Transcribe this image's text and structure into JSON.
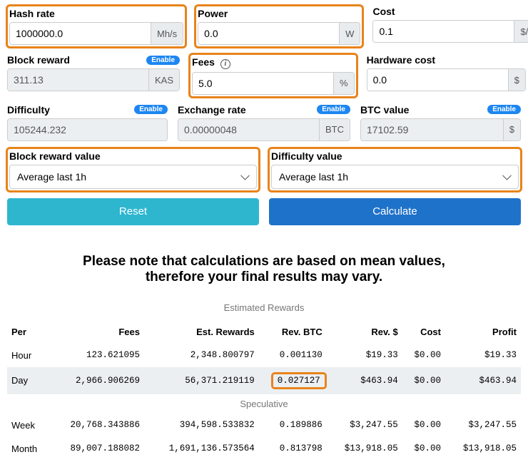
{
  "labels": {
    "hash_rate": "Hash rate",
    "power": "Power",
    "cost": "Cost",
    "block_reward": "Block reward",
    "fees": "Fees",
    "hardware_cost": "Hardware cost",
    "difficulty": "Difficulty",
    "exchange_rate": "Exchange rate",
    "btc_value": "BTC value",
    "block_reward_value": "Block reward value",
    "difficulty_value": "Difficulty value",
    "enable": "Enable",
    "reset": "Reset",
    "calculate": "Calculate"
  },
  "units": {
    "hash_rate": "Mh/s",
    "power": "W",
    "cost": "$/kWh",
    "block_reward": "KAS",
    "fees": "%",
    "hardware_cost": "$",
    "exchange_rate": "BTC",
    "btc_value": "$"
  },
  "values": {
    "hash_rate": "1000000.0",
    "power": "0.0",
    "cost": "0.1",
    "block_reward": "311.13",
    "fees": "5.0",
    "hardware_cost": "0.0",
    "difficulty": "105244.232",
    "exchange_rate": "0.00000048",
    "btc_value": "17102.59"
  },
  "selects": {
    "block_reward_value": "Average last 1h",
    "difficulty_value": "Average last 1h"
  },
  "note": {
    "l1": "Please note that calculations are based on mean values,",
    "l2": "therefore your final results may vary."
  },
  "table": {
    "subhead1": "Estimated Rewards",
    "subhead2": "Speculative",
    "headers": [
      "Per",
      "Fees",
      "Est. Rewards",
      "Rev. BTC",
      "Rev. $",
      "Cost",
      "Profit"
    ],
    "rows": [
      {
        "per": "Hour",
        "fees": "123.621095",
        "est": "2,348.800797",
        "revbtc": "0.001130",
        "revd": "$19.33",
        "cost": "$0.00",
        "profit": "$19.33",
        "shade": false,
        "hl": false
      },
      {
        "per": "Day",
        "fees": "2,966.906269",
        "est": "56,371.219119",
        "revbtc": "0.027127",
        "revd": "$463.94",
        "cost": "$0.00",
        "profit": "$463.94",
        "shade": true,
        "hl": true
      }
    ],
    "spec": [
      {
        "per": "Week",
        "fees": "20,768.343886",
        "est": "394,598.533832",
        "revbtc": "0.189886",
        "revd": "$3,247.55",
        "cost": "$0.00",
        "profit": "$3,247.55"
      },
      {
        "per": "Month",
        "fees": "89,007.188082",
        "est": "1,691,136.573564",
        "revbtc": "0.813798",
        "revd": "$13,918.05",
        "cost": "$0.00",
        "profit": "$13,918.05"
      }
    ]
  }
}
